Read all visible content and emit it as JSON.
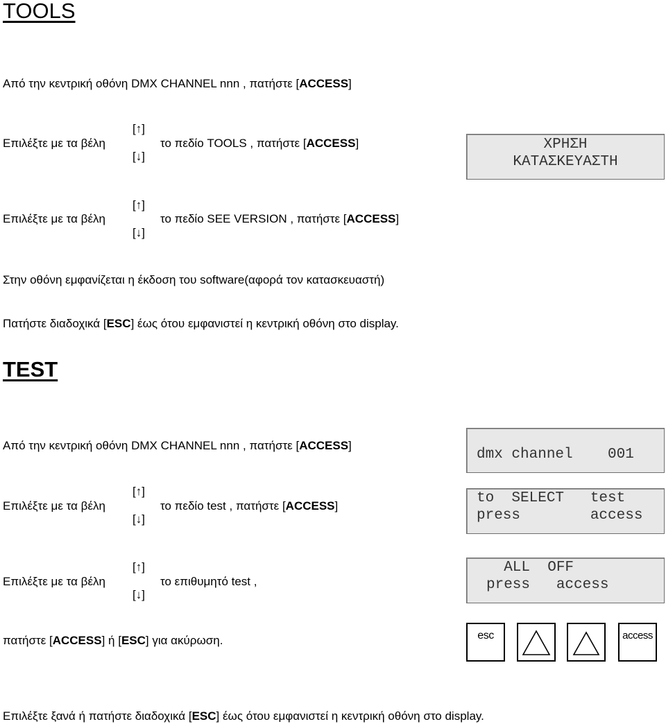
{
  "tools_section": {
    "title": "TOOLS",
    "step1": {
      "prefix": "Από την κεντρική οθόνη  DMX CHANNEL nnn , πατήστε [",
      "key": "ACCESS",
      "suffix": "]"
    },
    "step2": {
      "prefix": "Επιλέξτε με τα βέλη",
      "arrow_up": "[↑]",
      "arrow_down": "[↓]",
      "middle": "το πεδίο  TOOLS , πατήστε [",
      "key": "ACCESS",
      "suffix": "]"
    },
    "step3": {
      "prefix": "Επιλέξτε με τα βέλη",
      "arrow_up": "[↑]",
      "arrow_down": "[↓]",
      "middle": "το πεδίο  SEE VERSION , πατήστε [",
      "key": "ACCESS",
      "suffix": "]"
    },
    "step4": "Στην οθόνη εμφανίζεται η έκδοση του software(αφορά τον κατασκευαστή)",
    "step5": {
      "prefix": "Πατήστε διαδοχικά [",
      "key": "ESC",
      "suffix": "] έως ότου εμφανιστεί η κεντρική οθόνη στο display."
    },
    "display": {
      "line1": "ΧΡΗΣΗ",
      "line2": "ΚΑΤΑΣΚΕΥΑΣΤΗ"
    }
  },
  "test_section": {
    "title": "TEST",
    "step1": {
      "prefix": "Από την κεντρική οθόνη  DMX CHANNEL nnn , πατήστε [",
      "key": "ACCESS",
      "suffix": "]"
    },
    "step2": {
      "prefix": "Επιλέξτε με τα βέλη",
      "arrow_up": "[↑]",
      "arrow_down": "[↓]",
      "middle": "το πεδίο  test , πατήστε [",
      "key": "ACCESS",
      "suffix": "]"
    },
    "step3": {
      "prefix": "Επιλέξτε με τα βέλη",
      "arrow_up": "[↑]",
      "arrow_down": "[↓]",
      "middle": "το επιθυμητό test ,"
    },
    "step4": {
      "prefix": "πατήστε [",
      "key1": "ACCESS",
      "mid": "] ή [",
      "key2": "ESC",
      "suffix": "] για ακύρωση."
    },
    "step5": {
      "prefix": "Επιλέξτε ξανά ή πατήστε διαδοχικά [",
      "key": "ESC",
      "suffix": "] έως ότου εμφανιστεί η κεντρική οθόνη στο display."
    },
    "display1": {
      "line1": "dmx channel    001"
    },
    "display2": {
      "line1": "to  SELECT   test",
      "line2": "press        access"
    },
    "display3": {
      "line1": "  ALL  OFF",
      "line2": "press   access"
    },
    "keypad": [
      {
        "label": "esc",
        "icon": ""
      },
      {
        "label": "",
        "icon": "up-triangle-icon"
      },
      {
        "label": "",
        "icon": "up-triangle-icon"
      },
      {
        "label": "access",
        "icon": ""
      }
    ]
  }
}
